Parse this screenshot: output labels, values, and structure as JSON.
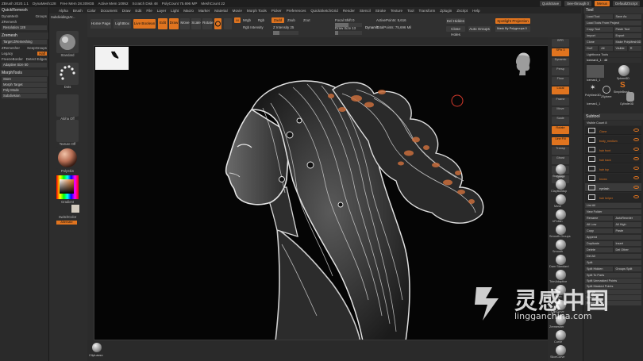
{
  "titlebar": {
    "app": "ZBrush 2020.1.1",
    "items": [
      "DynaMesh128",
      "Free Mem 28.309GB",
      "Active Mem 10952",
      "Scratch Disk 48",
      "PolyCount 75.696 MP",
      "MeshCount 22"
    ],
    "right": [
      "QuickSave",
      "See-through 0",
      "Menus",
      "DefaultZScript"
    ]
  },
  "menu": {
    "items": [
      "Alpha",
      "Brush",
      "Color",
      "Document",
      "Draw",
      "Edit",
      "File",
      "Layer",
      "Light",
      "Macro",
      "Marker",
      "Material",
      "Movie",
      "Morph Tools",
      "Picker",
      "Preferences",
      "QuickSketchGrid",
      "Render",
      "Stencil",
      "Stroke",
      "Texture",
      "Tool",
      "Transform",
      "Zplugin",
      "Zscript",
      "Help"
    ]
  },
  "left": {
    "title": "QuickRemesh",
    "rows": [
      {
        "a": "DynaMesh",
        "b": "Groups"
      },
      {
        "a": "ZRemesh",
        "b": ""
      },
      {
        "a": "Resolution 128",
        "b": ""
      }
    ],
    "zremesh_label": "Zremesh",
    "zremesh_field": "Target ZRemeshing",
    "opts": [
      {
        "a": "ZRemesher",
        "b": "KeepGroups"
      },
      {
        "a": "Legacy",
        "b": "Half"
      },
      {
        "a": "FreezeBorder",
        "b": "Detect Edges"
      },
      {
        "a": "Adaptive Size 50",
        "b": ""
      }
    ],
    "morph_title": "MorphTools",
    "morph_rows": [
      "Store",
      "Morph Target",
      "Poly Mode",
      "Subdivision"
    ]
  },
  "palette": {
    "standard": "Standard",
    "dots": "Dots",
    "alpha": "Alpha Off",
    "texture": "Texture Off",
    "material": "PolySkin",
    "gradient": "Gradient",
    "switch": "SwitchColor",
    "alternate": "Alternate",
    "color_main": "#e0741f",
    "color_secondary": "#d4ccbf"
  },
  "toolbar": {
    "home": "Home Page",
    "lightbox": "LightBox",
    "live_boolean": "Live Boolean",
    "edit": "Edit",
    "draw": "Draw",
    "move": "Move",
    "scale": "Scale",
    "rotate": "Rotate",
    "mrgb": "Mrgb",
    "rgb": "Rgb",
    "m": "M",
    "rgb_intensity": "Rgb Intensity",
    "zadd": "Zadd",
    "zsub": "Zsub",
    "zcut": "Zcut",
    "z_intensity": "Z Intensity 25",
    "focal": "Focal Shift 0",
    "draw_size": "Draw Size 13",
    "dynamic": "Dynamic",
    "active_points": "ActivePoints: 5,616",
    "total_points": "TotalPoints: 75,696 Mil",
    "dot_hidden": "Del Hidden",
    "close_holes": "Close Holes",
    "auto_groups": "Auto Groups",
    "spotlight": "Spotlight Projection",
    "mask_polygroup": "Mask By Polygroups 0"
  },
  "dock": {
    "labels": [
      "BPR",
      "SPix 3",
      "Dynamic",
      "Persp",
      "Floor",
      "Local",
      "Frame",
      "Move",
      "Scale",
      "Rotate",
      "Line Fill",
      "Transp",
      "Ghost",
      "Solo",
      "Xpose"
    ],
    "brushes": [
      "Standard",
      "ClayBuildup",
      "Move",
      "hPolish",
      "Smooth Groups",
      "Smooth",
      "Dam Standard",
      "TrimAdaptive",
      "Pinch",
      "ClipCurve",
      "Zremesher",
      "Curve",
      "SliceCurve"
    ]
  },
  "tool": {
    "title": "Tool",
    "rows": [
      [
        "Load Tool",
        "Save As"
      ],
      [
        "Load Tools From Project",
        ""
      ],
      [
        "Copy Tool",
        "Paste Tool"
      ],
      [
        "Import",
        "Export"
      ],
      [
        "Clone",
        "Make PolyMesh3D"
      ],
      [
        "GoZ",
        "All",
        "Visible",
        "R"
      ]
    ],
    "lightbox_tools": "Lightbox ▸ Tools",
    "tool_name": "Iceman1_1 . 48",
    "thumbs": [
      "Iceman1_1",
      "Sphere3D",
      "SimpleBrush",
      "PolyMesh3D",
      "ZSphere",
      "Cylinder3D",
      "Iceman1_1"
    ],
    "subtool": "Subtool",
    "visible_count": "Visible Count 8",
    "subtools": [
      "Clone",
      "body_medium",
      "hair front",
      "hair back",
      "hair top",
      "brows",
      "eyelash",
      "hair helper"
    ],
    "actions": [
      [
        "List All",
        ""
      ],
      [
        "New Folder",
        ""
      ],
      [
        "Rename",
        "AutoReorder"
      ],
      [
        "All Low",
        "All High"
      ],
      [
        "Copy",
        "Paste"
      ],
      [
        "Append",
        ""
      ],
      [
        "Duplicate",
        "Insert"
      ],
      [
        "Delete",
        "Del Other"
      ],
      [
        "Del All",
        ""
      ],
      [
        "Split",
        ""
      ],
      [
        "Split Hidden",
        "Groups Split"
      ],
      [
        "Split To Parts",
        ""
      ],
      [
        "Split Unmasked Points",
        ""
      ],
      [
        "Split Masked Points",
        ""
      ],
      [
        "Merge",
        ""
      ],
      [
        "Boolean",
        ""
      ],
      [
        "Remesh",
        ""
      ]
    ]
  },
  "bottom": {
    "cliplasso": "ClipLasso"
  },
  "watermark": {
    "cn": "灵感中国",
    "en": "lingganchina.com"
  }
}
